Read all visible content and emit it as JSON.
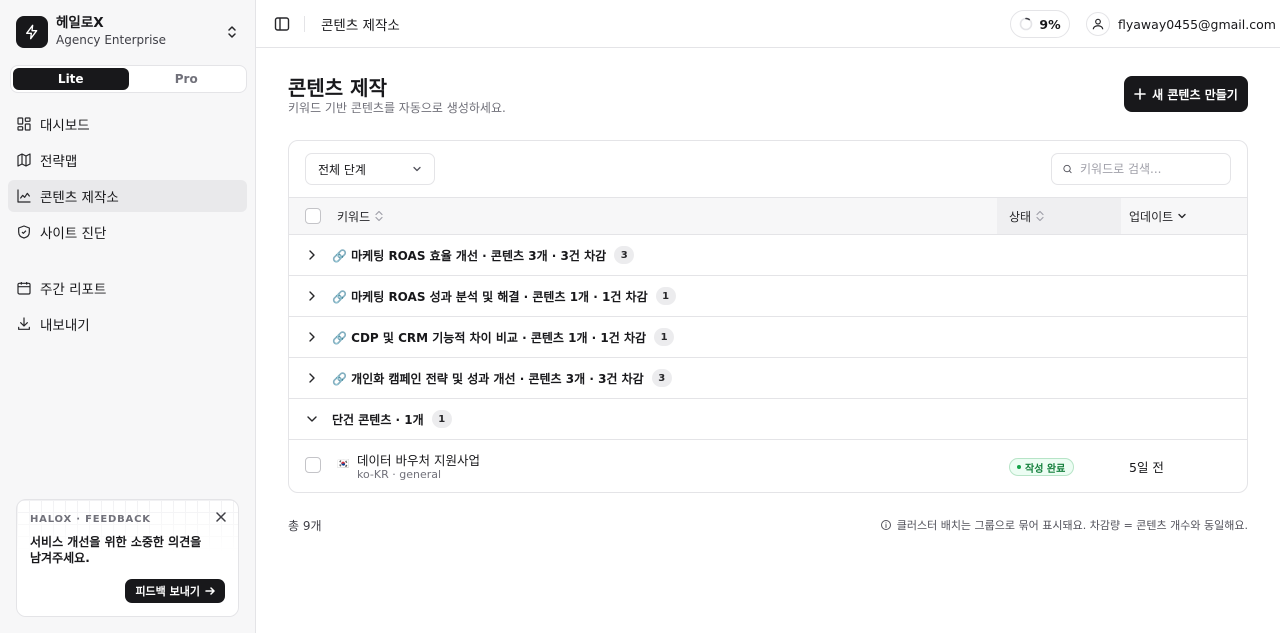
{
  "brand": {
    "name": "헤일로X",
    "plan": "Agency Enterprise"
  },
  "mode_toggle": {
    "options": [
      "Lite",
      "Pro"
    ],
    "selected": "Lite"
  },
  "nav": {
    "items": [
      {
        "label": "대시보드",
        "icon": "dashboard-icon"
      },
      {
        "label": "전략맵",
        "icon": "map-icon"
      },
      {
        "label": "콘텐츠 제작소",
        "icon": "chart-icon",
        "active": true
      },
      {
        "label": "사이트 진단",
        "icon": "shield-check-icon"
      },
      {
        "label": "주간 리포트",
        "icon": "calendar-icon"
      },
      {
        "label": "내보내기",
        "icon": "download-icon"
      }
    ]
  },
  "feedback": {
    "tag": "HALOX · FEEDBACK",
    "message": "서비스 개선을 위한 소중한 의견을 남겨주세요.",
    "button": "피드백 보내기"
  },
  "header": {
    "breadcrumb": "콘텐츠 제작소",
    "usage": "9%",
    "email": "flyaway0455@gmail.com"
  },
  "page": {
    "title": "콘텐츠 제작",
    "subtitle": "키워드 기반 콘텐츠를 자동으로 생성하세요.",
    "new_button": "새 콘텐츠 만들기"
  },
  "filters": {
    "stage": "전체 단계",
    "search_placeholder": "키워드로 검색...",
    "search_value": ""
  },
  "table": {
    "columns": {
      "keyword": "키워드",
      "status": "상태",
      "updated": "업데이트"
    },
    "groups": [
      {
        "prefix": "🔗",
        "label": "마케팅 ROAS 효율 개선 · 콘텐츠 3개 · 3건 차감",
        "count": "3",
        "expanded": false
      },
      {
        "prefix": "🔗",
        "label": "마케팅 ROAS 성과 분석 및 해결 · 콘텐츠 1개 · 1건 차감",
        "count": "1",
        "expanded": false
      },
      {
        "prefix": "🔗",
        "label": "CDP 및 CRM 기능적 차이 비교 · 콘텐츠 1개 · 1건 차감",
        "count": "1",
        "expanded": false
      },
      {
        "prefix": "🔗",
        "label": "개인화 캠페인 전략 및 성과 개선 · 콘텐츠 3개 · 3건 차감",
        "count": "3",
        "expanded": false
      },
      {
        "prefix": "",
        "label": "단건 콘텐츠 · 1개",
        "count": "1",
        "expanded": true
      }
    ],
    "rows": [
      {
        "flag": "🇰🇷",
        "title": "데이터 바우처 지원사업",
        "meta": "ko-KR · general",
        "status": "작성 완료",
        "updated": "5일 전"
      }
    ]
  },
  "footer": {
    "total": "총 9개",
    "note": "클러스터 배치는 그룹으로 묶어 표시돼요. 차감량 = 콘텐츠 개수와 동일해요."
  },
  "colors": {
    "primary": "#18181b",
    "success": "#15803d",
    "border": "#e4e4e7",
    "sidebar_bg": "#f7f7f8"
  }
}
